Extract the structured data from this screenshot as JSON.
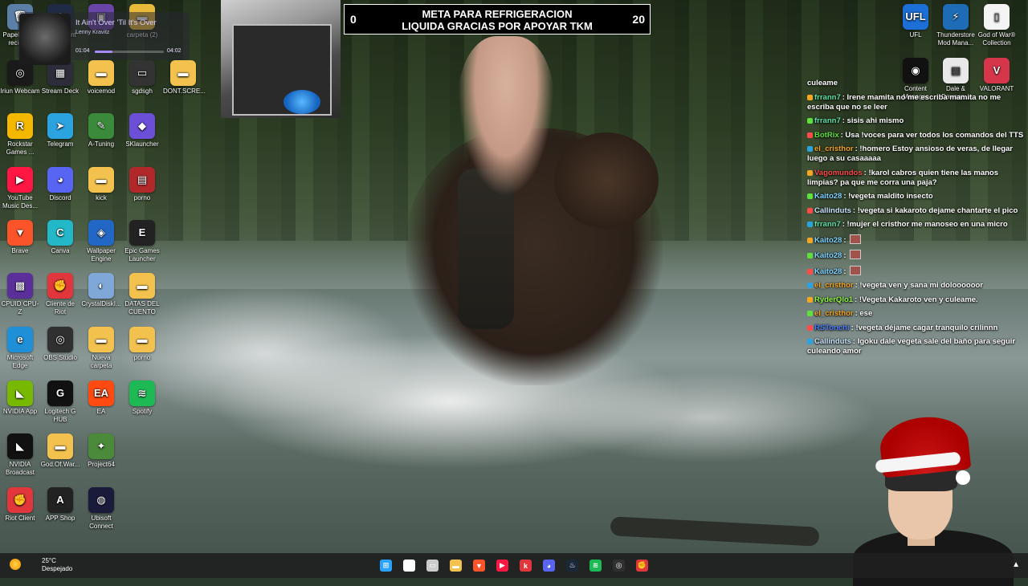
{
  "banner": {
    "left_count": "0",
    "title_line1": "META PARA REFRIGERACION",
    "title_line2": "LIQUIDA GRACIAS POR APOYAR TKM",
    "right_count": "20"
  },
  "player": {
    "song": "It Ain't Over 'Til It's Over",
    "artist": "Lenny Kravitz",
    "elapsed": "01:04",
    "duration": "04:02",
    "progress": 0.26
  },
  "desktop_left": [
    {
      "label": "Papelera de reciclaje",
      "color": "#5b7fa6",
      "glyph": "🗑"
    },
    {
      "label": "OBS Client",
      "color": "#1f2a44",
      "glyph": "◉"
    },
    {
      "label": "",
      "color": "#6a45a8",
      "glyph": "▣"
    },
    {
      "label": "carpeta (2)",
      "color": "#e8b93a",
      "glyph": "▬"
    },
    {
      "label": "Iriun Webcam",
      "color": "#1a1a1a",
      "glyph": "◎"
    },
    {
      "label": "Stream Deck",
      "color": "#2c2c3a",
      "glyph": "▦"
    },
    {
      "label": "voicemod",
      "color": "#f2c14e",
      "glyph": "▬"
    },
    {
      "label": "sgdsgh",
      "color": "#333",
      "glyph": "▭"
    },
    {
      "label": "DONT.SCRE...",
      "color": "#f2c14e",
      "glyph": "▬"
    },
    {
      "label": "Rockstar Games ...",
      "color": "#f5b800",
      "glyph": "R"
    },
    {
      "label": "Telegram",
      "color": "#2aa3e0",
      "glyph": "➤"
    },
    {
      "label": "A-Tuning",
      "color": "#3b8a3b",
      "glyph": "✎"
    },
    {
      "label": "SKlauncher",
      "color": "#6b4fd6",
      "glyph": "◆"
    },
    {
      "label": "YouTube Music Des...",
      "color": "#ff1744",
      "glyph": "▶"
    },
    {
      "label": "Discord",
      "color": "#5865f2",
      "glyph": "◕"
    },
    {
      "label": "kick",
      "color": "#f2c14e",
      "glyph": "▬"
    },
    {
      "label": "porno",
      "color": "#b0282a",
      "glyph": "▤"
    },
    {
      "label": "Brave",
      "color": "#fb542b",
      "glyph": "▼"
    },
    {
      "label": "Canva",
      "color": "#22b8c8",
      "glyph": "C"
    },
    {
      "label": "Wallpaper Engine",
      "color": "#2367c6",
      "glyph": "◈"
    },
    {
      "label": "Epic Games Launcher",
      "color": "#222",
      "glyph": "E"
    },
    {
      "label": "CPUID CPU-Z",
      "color": "#5a2f9a",
      "glyph": "▩"
    },
    {
      "label": "Cliente de Riot",
      "color": "#e0363c",
      "glyph": "✊"
    },
    {
      "label": "CrystalDiskI...",
      "color": "#7fa8d8",
      "glyph": "◐"
    },
    {
      "label": "DATAS DEL CUENTO",
      "color": "#f2c14e",
      "glyph": "▬"
    },
    {
      "label": "Microsoft Edge",
      "color": "#1f8fd8",
      "glyph": "e"
    },
    {
      "label": "OBS Studio",
      "color": "#303030",
      "glyph": "◎"
    },
    {
      "label": "Nueva carpeta",
      "color": "#f2c14e",
      "glyph": "▬"
    },
    {
      "label": "porno",
      "color": "#f2c14e",
      "glyph": "▬"
    },
    {
      "label": "NVIDIA App",
      "color": "#76b900",
      "glyph": "◣"
    },
    {
      "label": "Logitech G HUB",
      "color": "#111",
      "glyph": "G"
    },
    {
      "label": "EA",
      "color": "#ff4a12",
      "glyph": "EA"
    },
    {
      "label": "Spotify",
      "color": "#1db954",
      "glyph": "≋"
    },
    {
      "label": "NVIDIA Broadcast",
      "color": "#111",
      "glyph": "◣"
    },
    {
      "label": "God.Of.War...",
      "color": "#f2c14e",
      "glyph": "▬"
    },
    {
      "label": "Project64",
      "color": "#4a8a3a",
      "glyph": "✦"
    },
    {
      "label": "Riot Client",
      "color": "#e0363c",
      "glyph": "✊"
    },
    {
      "label": "APP Shop",
      "color": "#222",
      "glyph": "A"
    },
    {
      "label": "Ubisoft Connect",
      "color": "#1a1a3a",
      "glyph": "◍"
    }
  ],
  "desktop_right": [
    {
      "label": "UFL",
      "color": "#1c6fd6",
      "glyph": "UFL"
    },
    {
      "label": "Thunderstore Mod Mana...",
      "color": "#1e6cb5",
      "glyph": "⚡"
    },
    {
      "label": "God of War® Collection",
      "color": "#f4f4f4",
      "glyph": "▯"
    },
    {
      "label": "Content Manager",
      "color": "#111",
      "glyph": "◉"
    },
    {
      "label": "Dale & Dawson...",
      "color": "#e8e8e8",
      "glyph": "▤"
    },
    {
      "label": "VALORANT",
      "color": "#d6364a",
      "glyph": "V"
    }
  ],
  "chat": [
    {
      "user": "",
      "color": "#ffffff",
      "text": "culeame"
    },
    {
      "user": "frrann7",
      "color": "#5ee1a8",
      "text": ": Irene mamita no me escriba mamita no me escriba que no se leer"
    },
    {
      "user": "frrann7",
      "color": "#5ee1a8",
      "text": ": sisis ahi mismo"
    },
    {
      "user": "BotRix",
      "color": "#5ee13c",
      "text": ": Usa !voces para ver todos los comandos del TTS"
    },
    {
      "user": "el_cristhor",
      "color": "#f5a623",
      "text": ": !homero Estoy ansioso de veras, de llegar luego a su casaaaaa"
    },
    {
      "user": "Vagomundos",
      "color": "#ff4a4a",
      "text": ": !karol cabros quien tiene las manos limpias? pa que me corra una paja?"
    },
    {
      "user": "Kaito28",
      "color": "#7fd3ff",
      "text": ": !vegeta maldito insecto"
    },
    {
      "user": "Callinduts",
      "color": "#c8e6ff",
      "text": ": !vegeta si kakaroto dejame chantarte el pico"
    },
    {
      "user": "frrann7",
      "color": "#5ee1a8",
      "text": ": !mujer el cristhor me manoseo en una micro"
    },
    {
      "user": "Kaito28",
      "color": "#7fd3ff",
      "text": ":"
    },
    {
      "user": "Kaito28",
      "color": "#7fd3ff",
      "text": ":"
    },
    {
      "user": "Kaito28",
      "color": "#7fd3ff",
      "text": ":"
    },
    {
      "user": "el_cristhor",
      "color": "#f5a623",
      "text": ": !vegeta ven y sana mi doloooooor"
    },
    {
      "user": "RyderQlo1",
      "color": "#8df542",
      "text": ": !Vegeta Kakaroto ven y culeame."
    },
    {
      "user": "el_cristhor",
      "color": "#f5a623",
      "text": ": ese"
    },
    {
      "user": "RSTonchi",
      "color": "#4a7bff",
      "text": ": !vegeta déjame cagar tranquilo crilinnn"
    },
    {
      "user": "Callinduts",
      "color": "#c8e6ff",
      "text": ": Igoku dale vegeta sale del baño para seguir culeando amor"
    }
  ],
  "taskbar": {
    "temperature": "25°C",
    "condition": "Despejado",
    "apps": [
      {
        "name": "start-icon",
        "glyph": "⊞",
        "color": "#2aa3ff"
      },
      {
        "name": "search-icon",
        "glyph": "⌕",
        "color": "#ffffff"
      },
      {
        "name": "task-view-icon",
        "glyph": "▭",
        "color": "#cccccc"
      },
      {
        "name": "file-explorer-icon",
        "glyph": "▬",
        "color": "#f2c14e"
      },
      {
        "name": "brave-icon",
        "glyph": "▼",
        "color": "#fb542b"
      },
      {
        "name": "youtube-music-icon",
        "glyph": "▶",
        "color": "#ff1744"
      },
      {
        "name": "kick-icon",
        "glyph": "k",
        "color": "#e0363c"
      },
      {
        "name": "discord-icon",
        "glyph": "◕",
        "color": "#5865f2"
      },
      {
        "name": "steam-icon",
        "glyph": "♨",
        "color": "#1b2838"
      },
      {
        "name": "spotify-icon",
        "glyph": "≋",
        "color": "#1db954"
      },
      {
        "name": "obs-icon",
        "glyph": "◎",
        "color": "#303030"
      },
      {
        "name": "riot-icon",
        "glyph": "✊",
        "color": "#e0363c"
      }
    ]
  }
}
